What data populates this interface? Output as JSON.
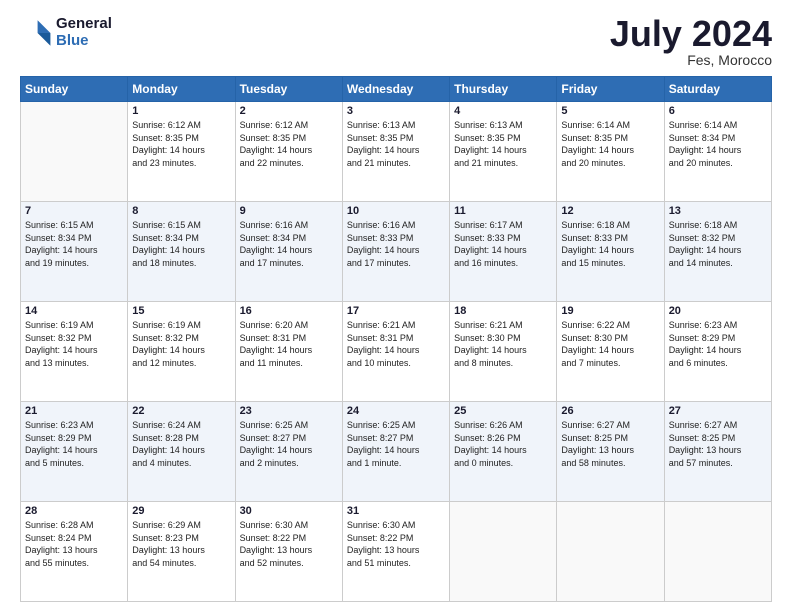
{
  "logo": {
    "line1": "General",
    "line2": "Blue"
  },
  "title": "July 2024",
  "location": "Fes, Morocco",
  "days_header": [
    "Sunday",
    "Monday",
    "Tuesday",
    "Wednesday",
    "Thursday",
    "Friday",
    "Saturday"
  ],
  "weeks": [
    [
      {
        "day": "",
        "info": ""
      },
      {
        "day": "1",
        "info": "Sunrise: 6:12 AM\nSunset: 8:35 PM\nDaylight: 14 hours\nand 23 minutes."
      },
      {
        "day": "2",
        "info": "Sunrise: 6:12 AM\nSunset: 8:35 PM\nDaylight: 14 hours\nand 22 minutes."
      },
      {
        "day": "3",
        "info": "Sunrise: 6:13 AM\nSunset: 8:35 PM\nDaylight: 14 hours\nand 21 minutes."
      },
      {
        "day": "4",
        "info": "Sunrise: 6:13 AM\nSunset: 8:35 PM\nDaylight: 14 hours\nand 21 minutes."
      },
      {
        "day": "5",
        "info": "Sunrise: 6:14 AM\nSunset: 8:35 PM\nDaylight: 14 hours\nand 20 minutes."
      },
      {
        "day": "6",
        "info": "Sunrise: 6:14 AM\nSunset: 8:34 PM\nDaylight: 14 hours\nand 20 minutes."
      }
    ],
    [
      {
        "day": "7",
        "info": "Sunrise: 6:15 AM\nSunset: 8:34 PM\nDaylight: 14 hours\nand 19 minutes."
      },
      {
        "day": "8",
        "info": "Sunrise: 6:15 AM\nSunset: 8:34 PM\nDaylight: 14 hours\nand 18 minutes."
      },
      {
        "day": "9",
        "info": "Sunrise: 6:16 AM\nSunset: 8:34 PM\nDaylight: 14 hours\nand 17 minutes."
      },
      {
        "day": "10",
        "info": "Sunrise: 6:16 AM\nSunset: 8:33 PM\nDaylight: 14 hours\nand 17 minutes."
      },
      {
        "day": "11",
        "info": "Sunrise: 6:17 AM\nSunset: 8:33 PM\nDaylight: 14 hours\nand 16 minutes."
      },
      {
        "day": "12",
        "info": "Sunrise: 6:18 AM\nSunset: 8:33 PM\nDaylight: 14 hours\nand 15 minutes."
      },
      {
        "day": "13",
        "info": "Sunrise: 6:18 AM\nSunset: 8:32 PM\nDaylight: 14 hours\nand 14 minutes."
      }
    ],
    [
      {
        "day": "14",
        "info": "Sunrise: 6:19 AM\nSunset: 8:32 PM\nDaylight: 14 hours\nand 13 minutes."
      },
      {
        "day": "15",
        "info": "Sunrise: 6:19 AM\nSunset: 8:32 PM\nDaylight: 14 hours\nand 12 minutes."
      },
      {
        "day": "16",
        "info": "Sunrise: 6:20 AM\nSunset: 8:31 PM\nDaylight: 14 hours\nand 11 minutes."
      },
      {
        "day": "17",
        "info": "Sunrise: 6:21 AM\nSunset: 8:31 PM\nDaylight: 14 hours\nand 10 minutes."
      },
      {
        "day": "18",
        "info": "Sunrise: 6:21 AM\nSunset: 8:30 PM\nDaylight: 14 hours\nand 8 minutes."
      },
      {
        "day": "19",
        "info": "Sunrise: 6:22 AM\nSunset: 8:30 PM\nDaylight: 14 hours\nand 7 minutes."
      },
      {
        "day": "20",
        "info": "Sunrise: 6:23 AM\nSunset: 8:29 PM\nDaylight: 14 hours\nand 6 minutes."
      }
    ],
    [
      {
        "day": "21",
        "info": "Sunrise: 6:23 AM\nSunset: 8:29 PM\nDaylight: 14 hours\nand 5 minutes."
      },
      {
        "day": "22",
        "info": "Sunrise: 6:24 AM\nSunset: 8:28 PM\nDaylight: 14 hours\nand 4 minutes."
      },
      {
        "day": "23",
        "info": "Sunrise: 6:25 AM\nSunset: 8:27 PM\nDaylight: 14 hours\nand 2 minutes."
      },
      {
        "day": "24",
        "info": "Sunrise: 6:25 AM\nSunset: 8:27 PM\nDaylight: 14 hours\nand 1 minute."
      },
      {
        "day": "25",
        "info": "Sunrise: 6:26 AM\nSunset: 8:26 PM\nDaylight: 14 hours\nand 0 minutes."
      },
      {
        "day": "26",
        "info": "Sunrise: 6:27 AM\nSunset: 8:25 PM\nDaylight: 13 hours\nand 58 minutes."
      },
      {
        "day": "27",
        "info": "Sunrise: 6:27 AM\nSunset: 8:25 PM\nDaylight: 13 hours\nand 57 minutes."
      }
    ],
    [
      {
        "day": "28",
        "info": "Sunrise: 6:28 AM\nSunset: 8:24 PM\nDaylight: 13 hours\nand 55 minutes."
      },
      {
        "day": "29",
        "info": "Sunrise: 6:29 AM\nSunset: 8:23 PM\nDaylight: 13 hours\nand 54 minutes."
      },
      {
        "day": "30",
        "info": "Sunrise: 6:30 AM\nSunset: 8:22 PM\nDaylight: 13 hours\nand 52 minutes."
      },
      {
        "day": "31",
        "info": "Sunrise: 6:30 AM\nSunset: 8:22 PM\nDaylight: 13 hours\nand 51 minutes."
      },
      {
        "day": "",
        "info": ""
      },
      {
        "day": "",
        "info": ""
      },
      {
        "day": "",
        "info": ""
      }
    ]
  ]
}
